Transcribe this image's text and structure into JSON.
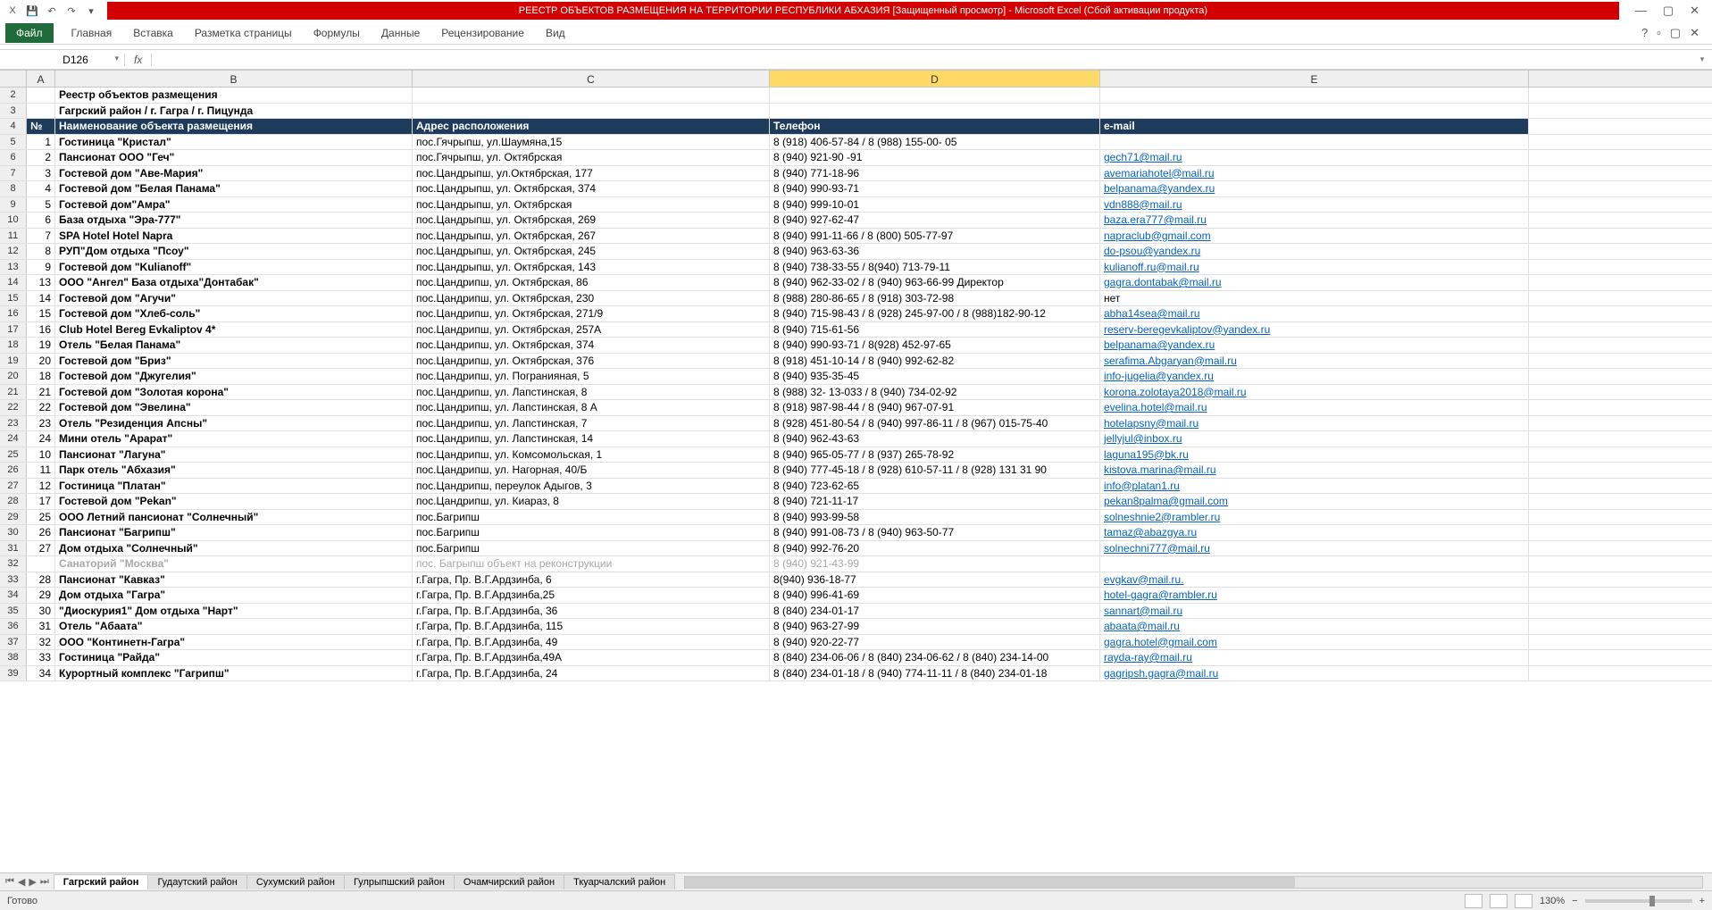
{
  "title": "РЕЕСТР ОБЪЕКТОВ РАЗМЕЩЕНИЯ НА ТЕРРИТОРИИ РЕСПУБЛИКИ АБХАЗИЯ   [Защищенный просмотр] - Microsoft Excel (Сбой активации продукта)",
  "ribbon": {
    "file": "Файл",
    "tabs": [
      "Главная",
      "Вставка",
      "Разметка страницы",
      "Формулы",
      "Данные",
      "Рецензирование",
      "Вид"
    ]
  },
  "namebox": "D126",
  "fx": "fx",
  "cols": [
    "A",
    "B",
    "C",
    "D",
    "E"
  ],
  "rowTitles": {
    "r2": "Реестр объектов размещения",
    "r3": "Гагрский район / г. Гагра / г. Пицунда"
  },
  "headers": {
    "num": "№",
    "name": "Наименование объекта размещения",
    "addr": "Адрес расположения",
    "phone": "Телефон",
    "email": "e-mail"
  },
  "rows": [
    {
      "rh": "5",
      "n": "1",
      "name": "Гостиница \"Кристал\"",
      "addr": "пос.Гячрыпш, ул.Шаумяна,15",
      "phone": "8 (918) 406-57-84 / 8 (988) 155-00- 05",
      "email": ""
    },
    {
      "rh": "6",
      "n": "2",
      "name": "Пансионат ООО \"Геч\"",
      "addr": "пос.Гячрыпш, ул. Октябрская",
      "phone": "8 (940) 921-90 -91",
      "email": "gech71@mail.ru"
    },
    {
      "rh": "7",
      "n": "3",
      "name": "Гостевой дом \"Аве-Мария\"",
      "addr": "пос.Цандрыпш, ул.Октябрская, 177",
      "phone": "8 (940) 771-18-96",
      "email": "avemariahotel@mail.ru"
    },
    {
      "rh": "8",
      "n": "4",
      "name": "Гостевой дом \"Белая Панама\"",
      "addr": "пос.Цандрыпш, ул. Октябрская, 374",
      "phone": "8 (940) 990-93-71",
      "email": "belpanama@yandex.ru"
    },
    {
      "rh": "9",
      "n": "5",
      "name": "Гостевой дом\"Амра\"",
      "addr": "пос.Цандрыпш, ул. Октябрская",
      "phone": "8 (940) 999-10-01",
      "email": "vdn888@mail.ru"
    },
    {
      "rh": "10",
      "n": "6",
      "name": "База отдыха \"Эра-777\"",
      "addr": "пос.Цандрыпш, ул. Октябрская, 269",
      "phone": "8 (940) 927-62-47",
      "email": "baza.era777@mail.ru"
    },
    {
      "rh": "11",
      "n": "7",
      "name": "SPA Hotel Hotel Napra",
      "addr": "пос.Цандрыпш, ул. Октябрская, 267",
      "phone": "8 (940) 991-11-66 / 8 (800) 505-77-97",
      "email": "napraclub@gmail.com"
    },
    {
      "rh": "12",
      "n": "8",
      "name": "РУП\"Дом отдыха \"Псоу\"",
      "addr": "пос.Цандрыпш, ул. Октябрская, 245",
      "phone": "8 (940) 963-63-36",
      "email": "do-psou@yandex.ru"
    },
    {
      "rh": "13",
      "n": "9",
      "name": "Гостевой дом \"Kulianoff\"",
      "addr": "пос.Цандрыпш, ул. Октябрская, 143",
      "phone": "8 (940) 738-33-55 / 8(940) 713-79-11",
      "email": "kulianoff.ru@mail.ru"
    },
    {
      "rh": "14",
      "n": "13",
      "name": "ООО \"Ангел\" База отдыха\"Донтабак\"",
      "addr": "пос.Цандрипш, ул. Октябрская, 86",
      "phone": "8 (940) 962-33-02 /  8 (940) 963-66-99 Директор",
      "email": "gagra.dontabak@mail.ru"
    },
    {
      "rh": "15",
      "n": "14",
      "name": "Гостевой дом \"Агучи\"",
      "addr": "пос.Цандрипш, ул. Октябрская, 230",
      "phone": "8 (988) 280-86-65 / 8 (918) 303-72-98",
      "email": "нет",
      "noLink": true
    },
    {
      "rh": "16",
      "n": "15",
      "name": "Гостевой дом \"Хлеб-соль\"",
      "addr": "пос.Цандрипш, ул. Октябрская, 271/9",
      "phone": "8 (940) 715-98-43 / 8 (928) 245-97-00 / 8 (988)182-90-12",
      "email": "abha14sea@mail.ru"
    },
    {
      "rh": "17",
      "n": "16",
      "name": "Club Hotel Bereg Evkaliptov 4*",
      "addr": "пос.Цандрипш, ул. Октябрская, 257А",
      "phone": "8 (940) 715-61-56",
      "email": "reserv-beregevkaliptov@yandex.ru"
    },
    {
      "rh": "18",
      "n": "19",
      "name": "Отель \"Белая Панама\"",
      "addr": "пос.Цандрипш, ул. Октябрская, 374",
      "phone": "8 (940) 990-93-71 / 8(928) 452-97-65",
      "email": "belpanama@yandex.ru"
    },
    {
      "rh": "19",
      "n": "20",
      "name": "Гостевой дом \"Бриз\"",
      "addr": "пос.Цандрипш, ул. Октябрская, 376",
      "phone": "8 (918) 451-10-14 / 8 (940) 992-62-82",
      "email": "serafima.Abgaryan@mail.ru"
    },
    {
      "rh": "20",
      "n": "18",
      "name": "Гостевой дом \"Джугелия\"",
      "addr": "пос.Цандрипш, ул. Погранияная, 5",
      "phone": "8 (940) 935-35-45",
      "email": "info-jugelia@yandex.ru"
    },
    {
      "rh": "21",
      "n": "21",
      "name": "Гостевой дом \"Золотая корона\"",
      "addr": "пос.Цандрипш, ул. Лапстинская, 8",
      "phone": "8 (988) 32- 13-033 / 8 (940) 734-02-92",
      "email": "korona.zolotaya2018@mail.ru"
    },
    {
      "rh": "22",
      "n": "22",
      "name": "Гостевой дом \"Эвелина\"",
      "addr": "пос.Цандрипш, ул. Лапстинская, 8 А",
      "phone": "8 (918) 987-98-44 / 8 (940) 967-07-91",
      "email": "evelina.hotel@mail.ru"
    },
    {
      "rh": "23",
      "n": "23",
      "name": "Отель \"Резиденция Апсны\"",
      "addr": "пос.Цандрипш, ул. Лапстинская, 7",
      "phone": "8 (928) 451-80-54 / 8 (940) 997-86-11 / 8 (967) 015-75-40",
      "email": "hotelapsny@mail.ru"
    },
    {
      "rh": "24",
      "n": "24",
      "name": "Мини отель \"Арарат\"",
      "addr": "пос.Цандрипш, ул. Лапстинская, 14",
      "phone": "8 (940) 962-43-63",
      "email": "jellyjul@inbox.ru"
    },
    {
      "rh": "25",
      "n": "10",
      "name": "Пансионат \"Лагуна\"",
      "addr": "пос.Цандрипш, ул. Комсомольская, 1",
      "phone": "8 (940) 965-05-77 /  8 (937) 265-78-92",
      "email": "laguna195@bk.ru"
    },
    {
      "rh": "26",
      "n": "11",
      "name": "Парк отель \"Абхазия\"",
      "addr": "пос.Цандрипш, ул. Нагорная, 40/Б",
      "phone": "8 (940) 777-45-18 / 8 (928) 610-57-11 / 8 (928) 131 31 90",
      "email": "kistova.marina@mail.ru"
    },
    {
      "rh": "27",
      "n": "12",
      "name": "Гостиница \"Платан\"",
      "addr": "пос.Цандрипш, переулок Адыгов, 3",
      "phone": "8 (940) 723-62-65",
      "email": "info@platan1.ru"
    },
    {
      "rh": "28",
      "n": "17",
      "name": "Гостевой дом \"Pekan\"",
      "addr": "пос.Цандрипш, ул. Киараз, 8",
      "phone": "8 (940) 721-11-17",
      "email": "pekan8palma@gmail.com"
    },
    {
      "rh": "29",
      "n": "25",
      "name": "ООО Летний пансионат \"Солнечный\"",
      "addr": "пос.Багрипш",
      "phone": "8 (940) 993-99-58",
      "email": "solneshnie2@rambler.ru"
    },
    {
      "rh": "30",
      "n": "26",
      "name": "Пансионат \"Багрипш\"",
      "addr": "пос.Багрипш",
      "phone": "8 (940) 991-08-73 /  8 (940) 963-50-77",
      "email": "tamaz@abazgya.ru"
    },
    {
      "rh": "31",
      "n": "27",
      "name": "Дом отдыха \"Солнечный\"",
      "addr": "пос.Багрипш",
      "phone": "8 (940) 992-76-20",
      "email": "solnechni777@mail.ru"
    },
    {
      "rh": "32",
      "n": "",
      "name": "Санаторий \"Москва\"",
      "addr": "пос. Багрыпш объект на реконструкции",
      "phone": "8 (940) 921-43-99",
      "email": "",
      "dim": true
    },
    {
      "rh": "33",
      "n": "28",
      "name": "Пансионат \"Кавказ\"",
      "addr": "г.Гагра, Пр. В.Г.Ардзинба, 6",
      "phone": "8(940) 936-18-77",
      "email": "evgkav@mail.ru."
    },
    {
      "rh": "34",
      "n": "29",
      "name": "Дом отдыха \"Гагра\"",
      "addr": "г.Гагра, Пр. В.Г.Ардзинба,25",
      "phone": "8 (940) 996-41-69",
      "email": "hotel-gagra@rambler.ru"
    },
    {
      "rh": "35",
      "n": "30",
      "name": "\"Диоскурия1\" Дом отдыха \"Нарт\"",
      "addr": "г.Гагра, Пр. В.Г.Ардзинба, 36",
      "phone": "8 (840) 234-01-17",
      "email": "sannart@mail.ru"
    },
    {
      "rh": "36",
      "n": "31",
      "name": "Отель \"Абаата\"",
      "addr": "г.Гагра, Пр. В.Г.Ардзинба, 115",
      "phone": "8 (940) 963-27-99",
      "email": "abaata@mail.ru"
    },
    {
      "rh": "37",
      "n": "32",
      "name": "ООО \"Континетн-Гагра\"",
      "addr": "г.Гагра, Пр. В.Г.Ардзинба, 49",
      "phone": "8 (940) 920-22-77",
      "email": "gagra.hotel@gmail.com"
    },
    {
      "rh": "38",
      "n": "33",
      "name": "Гостиница \"Райда\"",
      "addr": "г.Гагра, Пр. В.Г.Ардзинба,49А",
      "phone": "8 (840) 234-06-06 /  8 (840) 234-06-62 / 8 (840) 234-14-00",
      "email": "rayda-ray@mail.ru"
    },
    {
      "rh": "39",
      "n": "34",
      "name": "Курортный комплекс \"Гагрипш\"",
      "addr": "г.Гагра, Пр. В.Г.Ардзинба, 24",
      "phone": "8 (840) 234-01-18 /  8 (940) 774-11-11 / 8 (840) 234-01-18",
      "email": "gagripsh.gagra@mail.ru"
    }
  ],
  "sheets": [
    "Гагрский район",
    "Гудаутский район",
    "Сухумский район",
    "Гулрыпшский район",
    "Очамчирский район",
    "Ткуарчалский район"
  ],
  "status": {
    "ready": "Готово",
    "zoom": "130%",
    "minus": "−",
    "plus": "+"
  }
}
